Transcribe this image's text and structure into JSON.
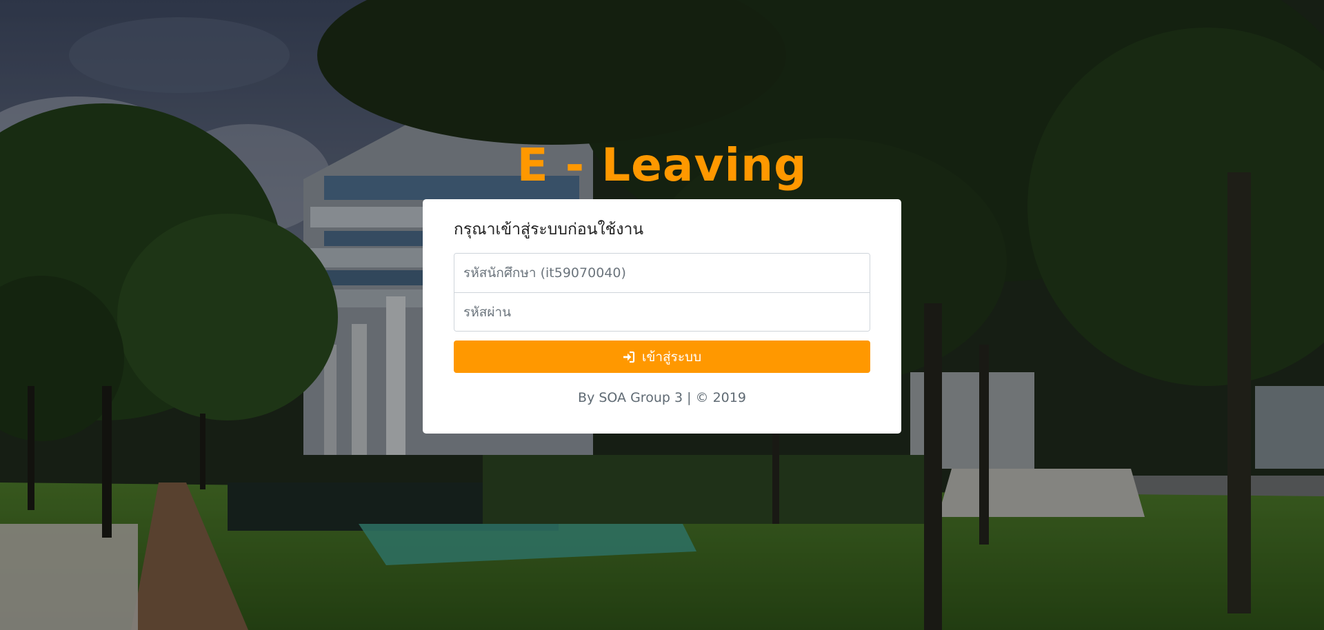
{
  "app": {
    "title": "E - Leaving"
  },
  "login_card": {
    "heading": "กรุณาเข้าสู่ระบบก่อนใช้งาน",
    "student_id_placeholder": "รหัสนักศึกษา (it59070040)",
    "password_placeholder": "รหัสผ่าน",
    "login_button_label": "เข้าสู่ระบบ",
    "login_button_icon": "sign-in-icon",
    "footer": "By SOA Group 3 | © 2019"
  },
  "colors": {
    "accent": "#ff9800",
    "card_background": "#ffffff",
    "footer_text": "#5f6a73"
  }
}
